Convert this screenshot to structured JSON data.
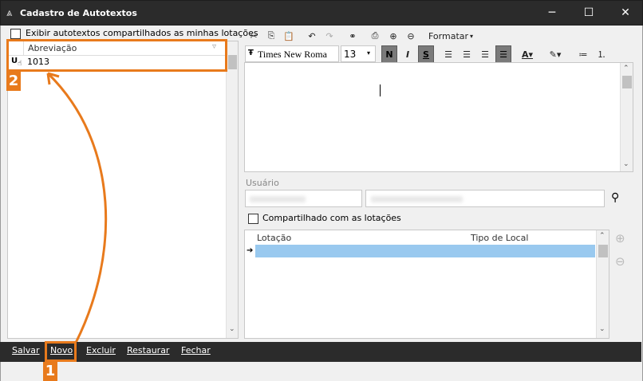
{
  "window": {
    "title": "Cadastro de Autotextos"
  },
  "left": {
    "show_shared_label": "Exibir autotextos compartilhados as minhas lotações",
    "column_header": "Abreviação",
    "rows": [
      {
        "value": "1013"
      }
    ]
  },
  "toolbar": {
    "format_menu": "Formatar",
    "font_name": "Times New Roma",
    "font_size": "13",
    "bold": "N",
    "italic": "I",
    "strike": "S"
  },
  "user_section": {
    "label": "Usuário"
  },
  "shared_section": {
    "label": "Compartilhado com as lotações",
    "columns": [
      "Lotação",
      "Tipo de Local"
    ]
  },
  "bottom": {
    "save": "Salvar",
    "new": "Novo",
    "delete": "Excluir",
    "restore": "Restaurar",
    "close": "Fechar"
  },
  "annotations": {
    "badge1": "1",
    "badge2": "2"
  },
  "colors": {
    "annotation": "#e87a1c",
    "selection": "#99c9ef",
    "titlebar": "#2b2b2b"
  }
}
